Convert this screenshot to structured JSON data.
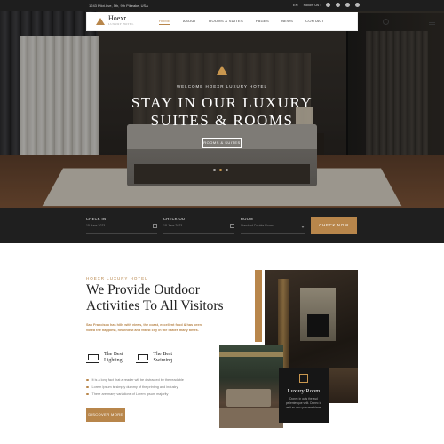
{
  "topbar": {
    "address": "1243 Pilot Ave, 5th, 9th Pikeake, USA",
    "follow_label": "Follow Us :",
    "lang": "EN"
  },
  "header": {
    "logo_name": "Hoexr",
    "logo_sub": "LUXURY HOTEL",
    "nav": [
      "HOME",
      "ABOUT",
      "ROOMS & SUITES",
      "PAGES",
      "NEWS",
      "CONTACT"
    ]
  },
  "hero": {
    "welcome": "WELCOME HOEXR LUXURY HOTEL",
    "title_line1": "STAY IN OUR LUXURY",
    "title_line2": "SUITES & ROOMS",
    "button": "ROOMS & SUITES"
  },
  "booking": {
    "check_in_label": "CHECK IN",
    "check_in_value": "15 June 2023",
    "check_out_label": "CHECK OUT",
    "check_out_value": "18 June 2023",
    "room_label": "ROOM",
    "room_value": "Standard Double Room",
    "button": "CHECK NOW"
  },
  "about": {
    "kicker": "HOEXR LUXURY HOTEL",
    "title_line1": "We Provide Outdoor",
    "title_line2": "Activities To All Visitors",
    "paragraph": "San Francisco has hills with views, the coast, excellent food & has been voted the happiest, healthiest and fittest city in the States many times.",
    "feature1_line1": "The Best",
    "feature1_line2": "Lighting",
    "feature2_line1": "The Best",
    "feature2_line2": "Swiming",
    "bullets": [
      "It is a long fact that a reader will be distracted by the readable",
      "Lorem Ipsum is simply dummy of the printing and industry",
      "There are many variations of Lorem Ipsum majority"
    ],
    "button": "DISCOVER MORE"
  },
  "card": {
    "title": "Luxury Room",
    "desc": "Donec in quis the asd pellentesque velit. Donec id velit ac arcu posuere blane."
  }
}
